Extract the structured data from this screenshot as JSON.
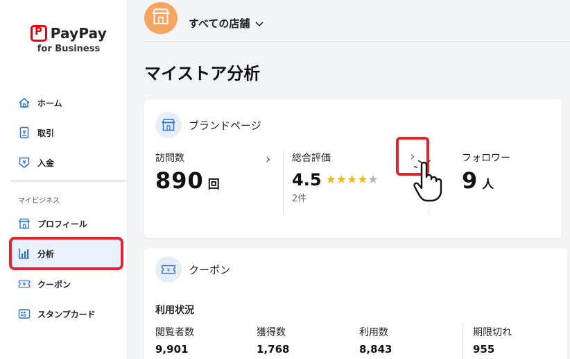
{
  "logo": {
    "name": "PayPay",
    "sub": "for Business"
  },
  "sidebar": {
    "items": [
      {
        "label": "ホーム",
        "icon": "home-icon"
      },
      {
        "label": "取引",
        "icon": "receipt-icon"
      },
      {
        "label": "入金",
        "icon": "deposit-icon"
      }
    ],
    "section_label": "マイビジネス",
    "section_items": [
      {
        "label": "プロフィール",
        "icon": "store-icon"
      },
      {
        "label": "分析",
        "icon": "chart-icon",
        "active": true
      },
      {
        "label": "クーポン",
        "icon": "coupon-icon"
      },
      {
        "label": "スタンプカード",
        "icon": "stamp-card-icon"
      }
    ]
  },
  "header": {
    "store_selector": "すべての店舗"
  },
  "page_title": "マイストア分析",
  "brand_page": {
    "title": "ブランドページ",
    "visits": {
      "label": "訪問数",
      "value": "890",
      "unit": "回"
    },
    "rating": {
      "label": "総合評価",
      "value": "4.5",
      "stars": 4.5,
      "count": "2件"
    },
    "followers": {
      "label": "フォロワー",
      "value": "9",
      "unit": "人"
    }
  },
  "coupon": {
    "title": "クーポン",
    "usage_label": "利用状況",
    "stats": [
      {
        "label": "閲覧者数",
        "value": "9,901"
      },
      {
        "label": "獲得数",
        "value": "1,768"
      },
      {
        "label": "利用数",
        "value": "8,843"
      },
      {
        "label": "期限切れ",
        "value": "955"
      }
    ]
  },
  "colors": {
    "accent": "#e3232f",
    "brand_red": "#e60012",
    "link_blue": "#2a6fd1",
    "store_avatar": "#f5a561",
    "star": "#f3b81b"
  }
}
